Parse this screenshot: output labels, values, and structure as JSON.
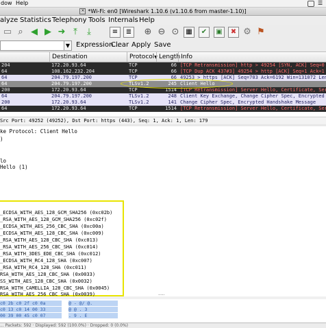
{
  "os_menubar": {
    "items": [
      "dow",
      "Help"
    ]
  },
  "titlebar": {
    "title": "*Wi-Fi: en0  [Wireshark 1.10.6  (v1.10.6 from master-1.10)]"
  },
  "app_menu": [
    "alyze",
    "Statistics",
    "Telephony",
    "Tools",
    "Internals",
    "Help"
  ],
  "toolbar_icons": [
    "file-icon",
    "search-icon",
    "back-arrow-icon",
    "forward-arrow-icon",
    "go-to-icon",
    "first-packet-icon",
    "last-packet-icon",
    "colorize-icon",
    "autoscroll-icon",
    "zoom-in-icon",
    "zoom-out-icon",
    "normal-size-icon",
    "resize-columns-icon",
    "capture-filters-icon",
    "display-filters-icon",
    "coloring-rules-icon",
    "preferences-icon",
    "help-icon"
  ],
  "filter": {
    "value": "",
    "expression_label": "Expression...",
    "clear_label": "Clear",
    "apply_label": "Apply",
    "save_label": "Save"
  },
  "columns": [
    "Destination",
    "Protocol",
    "Length",
    "Info"
  ],
  "packets": [
    {
      "style": "dark",
      "src": "204",
      "dst": "172.20.93.64",
      "proto": "TCP",
      "len": "66",
      "info": "[TCP Retransmission] http > 49254 [SYN, ACK] Seq=0 Ack=1"
    },
    {
      "style": "dark",
      "src": "64",
      "dst": "108.162.232.204",
      "proto": "TCP",
      "len": "66",
      "info": "[TCP Dup ACK 437#3] 49254 > http [ACK] Seq=1 Ack=1 Win"
    },
    {
      "style": "light",
      "src": "64",
      "dst": "204.79.197.200",
      "proto": "TCP",
      "len": "66",
      "info": "49253 > https [ACK] Seq=703 Ack=6192 Win=131072 Len"
    },
    {
      "style": "sel",
      "src": "64",
      "dst": "204.79.197.200",
      "proto": "TLSv1.2",
      "len": "245",
      "info": "Client Hello"
    },
    {
      "style": "dark",
      "src": "200",
      "dst": "172.20.93.64",
      "proto": "TCP",
      "len": "1514",
      "info": "[TCP Retransmission] Server Hello, Certificate, Server"
    },
    {
      "style": "light",
      "src": "64",
      "dst": "204.79.197.200",
      "proto": "TLSv1.2",
      "len": "248",
      "info": "Client Key Exchange, Change Cipher Spec, Encrypted Hand"
    },
    {
      "style": "light",
      "src": "200",
      "dst": "172.20.93.64",
      "proto": "TLSv1.2",
      "len": "141",
      "info": "Change Cipher Spec, Encrypted Handshake Message"
    },
    {
      "style": "dark",
      "src": "64",
      "dst": "172.20.93.64",
      "proto": "TCP",
      "len": "1514",
      "info": "[TCP Retransmission] Server Hello, Certificate, Server"
    }
  ],
  "status_line": "Src Port: 49252 (49252), Dst Port: https (443), Seq: 1, Ack: 1, Len: 179",
  "details": [
    "ke Protocol: Client Hello",
    ")",
    "",
    "",
    "lo",
    "Hello (1)"
  ],
  "cipher_suites": [
    "_ECDSA_WITH_AES_128_GCM_SHA256 (0xc02b)",
    "_RSA_WITH_AES_128_GCM_SHA256 (0xc02f)",
    "_ECDSA_WITH_AES_256_CBC_SHA (0xc00a)",
    "_ECDSA_WITH_AES_128_CBC_SHA (0xc009)",
    "_RSA_WITH_AES_128_CBC_SHA (0xc013)",
    "_RSA_WITH_AES_256_CBC_SHA (0xc014)",
    "_RSA_WITH_3DES_EDE_CBC_SHA (0xc012)",
    "_ECDSA_WITH_RC4_128_SHA (0xc007)",
    "_RSA_WITH_RC4_128_SHA (0xc011)",
    "RSA_WITH_AES_128_CBC_SHA (0x0033)",
    "SS_WITH_AES_128_CBC_SHA (0x0032)",
    "RSA_WITH_CAMELLIA_128_CBC_SHA (0x0045)",
    "RSA_WITH_AES_256_CBC_SHA (0x0039)"
  ],
  "hex_rows": [
    {
      "a": "c0 2b c0 2f c0 0a",
      "b": "@ - @/ @."
    },
    {
      "a": "c0 13 c0 14 00 33",
      "b": "@ @ . 3"
    },
    {
      "a": "00 39 00 45 c0 07",
      "b": ". 9 . E"
    }
  ],
  "bottom_status": "... Packets: 592 · Displayed: 592 (100.0%) · Dropped: 0 (0.0%)"
}
